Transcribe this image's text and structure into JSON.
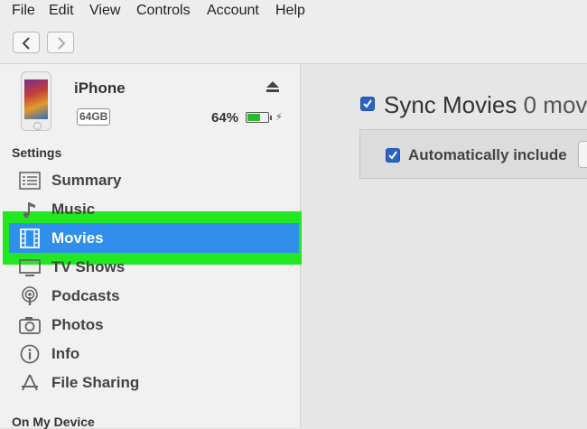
{
  "menubar": {
    "file": "File",
    "edit": "Edit",
    "view": "View",
    "controls": "Controls",
    "account": "Account",
    "help": "Help"
  },
  "device": {
    "name": "iPhone",
    "capacity": "64GB",
    "battery_percent": "64%",
    "battery_level": 0.64
  },
  "sidebar": {
    "settings_label": "Settings",
    "items": [
      {
        "label": "Summary",
        "icon": "summary-icon"
      },
      {
        "label": "Music",
        "icon": "music-icon"
      },
      {
        "label": "Movies",
        "icon": "movies-icon",
        "selected": true
      },
      {
        "label": "TV Shows",
        "icon": "tv-shows-icon"
      },
      {
        "label": "Podcasts",
        "icon": "podcasts-icon"
      },
      {
        "label": "Photos",
        "icon": "photos-icon"
      },
      {
        "label": "Info",
        "icon": "info-icon"
      },
      {
        "label": "File Sharing",
        "icon": "file-sharing-icon"
      }
    ],
    "on_my_device_label": "On My Device"
  },
  "main": {
    "sync_label": "Sync Movies",
    "sync_count": "0 mov",
    "sync_checked": true,
    "auto_include_label": "Automatically include",
    "auto_include_checked": true
  },
  "colors": {
    "selection": "#2f8fea",
    "highlight": "#22e822",
    "checkbox": "#2a63c6",
    "battery": "#2eb82e"
  }
}
